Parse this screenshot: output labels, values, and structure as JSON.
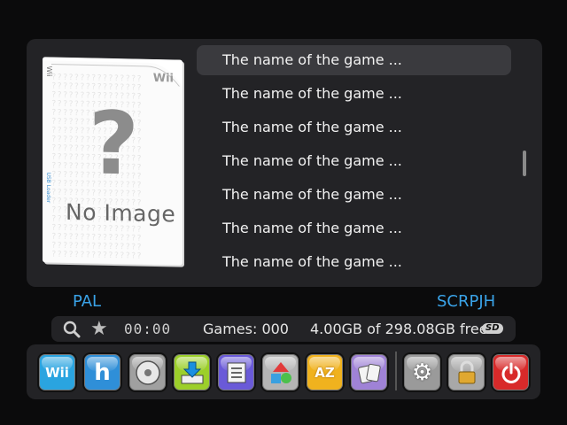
{
  "cover": {
    "brand": "Wii",
    "side_text": "Wii",
    "side_text2": "USB Loader",
    "placeholder_mark": "?",
    "placeholder_text": "No Image",
    "pattern": "????????????????\n????????????????\n????????????????\n????????????????\n????????????????\n????????????????\n????????????????\n????????????????\n????????????????\n????????????????\n????????????????\n????????????????\n????????????????\n????????????????\n????????????????\n????????????????\n????????????????\n????????????????\n????????????????\n????????????????\n????????????????"
  },
  "game_list": {
    "items": [
      {
        "label": "The name of the game ..."
      },
      {
        "label": "The name of the game ..."
      },
      {
        "label": "The name of the game ..."
      },
      {
        "label": "The name of the game ..."
      },
      {
        "label": "The name of the game ..."
      },
      {
        "label": "The name of the game ..."
      },
      {
        "label": "The name of the game ..."
      }
    ],
    "selected_index": 0
  },
  "info": {
    "region": "PAL",
    "game_id": "SCRPJH"
  },
  "status": {
    "clock": "00:00",
    "games_count": "Games: 000",
    "free_space": "4.00GB of 298.08GB free",
    "storage_badge": "SD",
    "icons": [
      "search-icon",
      "star-icon",
      "sd-card-icon"
    ]
  },
  "toolbar": {
    "buttons": [
      {
        "name": "wii-menu-button",
        "icon": "wii-icon",
        "glyph": "Wii",
        "color": "#2aa4e0"
      },
      {
        "name": "homebrew-button",
        "icon": "homebrew-icon",
        "glyph": "h",
        "color": "#2f8fd8"
      },
      {
        "name": "disc-button",
        "icon": "disc-icon",
        "glyph": "◉",
        "color": "#9a9a9a"
      },
      {
        "name": "install-button",
        "icon": "install-icon",
        "glyph": "⬇",
        "color": "#9ccf2a"
      },
      {
        "name": "list-view-button",
        "icon": "list-icon",
        "glyph": "☰",
        "color": "#6a5ad8"
      },
      {
        "name": "categories-button",
        "icon": "shapes-icon",
        "glyph": "◆",
        "color": "#b0b0b0"
      },
      {
        "name": "sort-az-button",
        "icon": "sort-az-icon",
        "glyph": "AZ",
        "color": "#f0b21e"
      },
      {
        "name": "cards-button",
        "icon": "cards-icon",
        "glyph": "❐",
        "color": "#9f82d6"
      },
      {
        "name": "settings-button",
        "icon": "gear-icon",
        "glyph": "⚙",
        "color": "#9a9a9a"
      },
      {
        "name": "lock-button",
        "icon": "lock-icon",
        "glyph": "🔒",
        "color": "#a8a8a8"
      },
      {
        "name": "power-button",
        "icon": "power-icon",
        "glyph": "⏻",
        "color": "#d82a2a"
      }
    ]
  }
}
